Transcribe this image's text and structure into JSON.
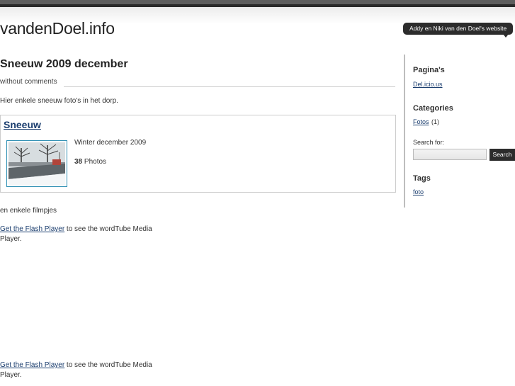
{
  "header": {
    "site_title": "vandenDoel.info",
    "tagline": "Addy en Niki van den Doel's website"
  },
  "post": {
    "title": "Sneeuw 2009 december",
    "meta": "without comments",
    "intro": "Hier enkele sneeuw foto's in het dorp.",
    "gallery": {
      "title": "Sneeuw",
      "description": "Winter december 2009",
      "count": "38",
      "count_label": "Photos"
    },
    "films_text": "en enkele filmpjes",
    "flash_players": [
      {
        "link": "Get the Flash Player",
        "text": " to see the wordTube Media Player."
      },
      {
        "link": "Get the Flash Player",
        "text": " to see the wordTube Media Player."
      }
    ]
  },
  "sidebar": {
    "pages_heading": "Pagina's",
    "pages": [
      {
        "label": "Del.icio.us"
      }
    ],
    "categories_heading": "Categories",
    "categories": [
      {
        "label": "Fotos",
        "count": "(1)"
      }
    ],
    "search_label": "Search for:",
    "search_value": "",
    "search_button": "Search",
    "tags_heading": "Tags",
    "tags": [
      {
        "label": "foto"
      }
    ]
  },
  "colors": {
    "link": "#1a3d6e",
    "dark_bar": "#2c2c2c",
    "thumb_border": "#2e8fb3"
  }
}
